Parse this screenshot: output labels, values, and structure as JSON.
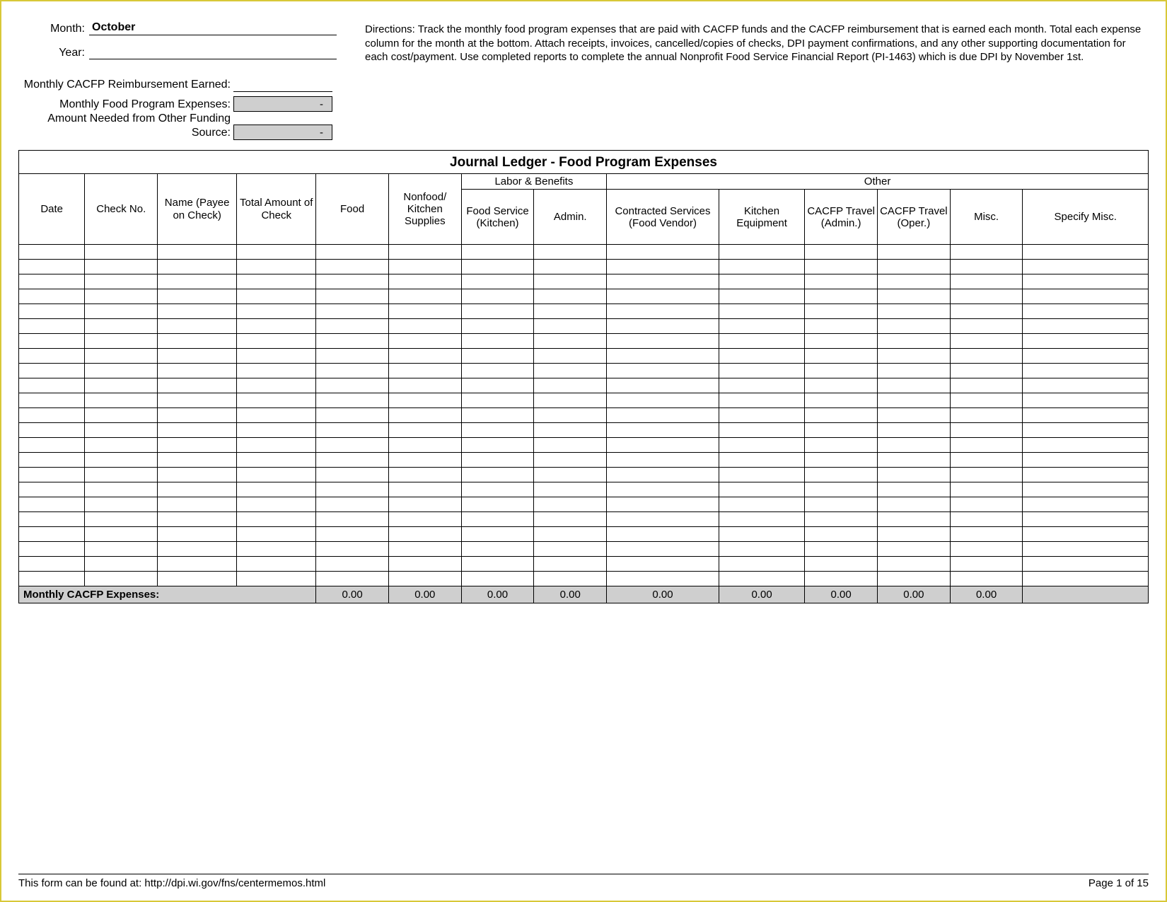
{
  "header": {
    "month_label": "Month:",
    "month_value": "October",
    "year_label": "Year:",
    "year_value": "",
    "reimb_label": "Monthly CACFP Reimbursement Earned:",
    "reimb_value": "",
    "expenses_label": "Monthly Food Program Expenses:",
    "expenses_value": "-",
    "other_funding_label": "Amount Needed from Other Funding Source:",
    "other_funding_value": "-",
    "directions": "Directions: Track the monthly food program expenses that are paid with CACFP funds and the CACFP reimbursement that is earned each month. Total each expense column for the month at the bottom. Attach receipts, invoices, cancelled/copies of checks, DPI payment confirmations, and any other supporting documentation for each cost/payment. Use completed reports to complete  the annual Nonprofit Food Service Financial Report (PI-1463) which is due DPI by November 1st."
  },
  "ledger": {
    "title": "Journal Ledger - Food Program Expenses",
    "group_labor": "Labor & Benefits",
    "group_other": "Other",
    "columns": {
      "date": "Date",
      "check_no": "Check No.",
      "name": "Name (Payee on Check)",
      "total_amount": "Total Amount of Check",
      "food": "Food",
      "nonfood": "Nonfood/ Kitchen Supplies",
      "food_service": "Food Service (Kitchen)",
      "admin": "Admin.",
      "contracted": "Contracted Services (Food Vendor)",
      "kitchen_equip": "Kitchen Equipment",
      "travel_admin": "CACFP Travel (Admin.)",
      "travel_oper": "CACFP Travel (Oper.)",
      "misc": "Misc.",
      "specify_misc": "Specify Misc."
    },
    "blank_row_count": 23,
    "totals": {
      "label": "Monthly CACFP Expenses:",
      "food": "0.00",
      "nonfood": "0.00",
      "food_service": "0.00",
      "admin": "0.00",
      "contracted": "0.00",
      "kitchen_equip": "0.00",
      "travel_admin": "0.00",
      "travel_oper": "0.00",
      "misc": "0.00",
      "specify_misc": ""
    }
  },
  "footer": {
    "left": "This form can be found at: http://dpi.wi.gov/fns/centermemos.html",
    "right": "Page 1 of 15"
  }
}
